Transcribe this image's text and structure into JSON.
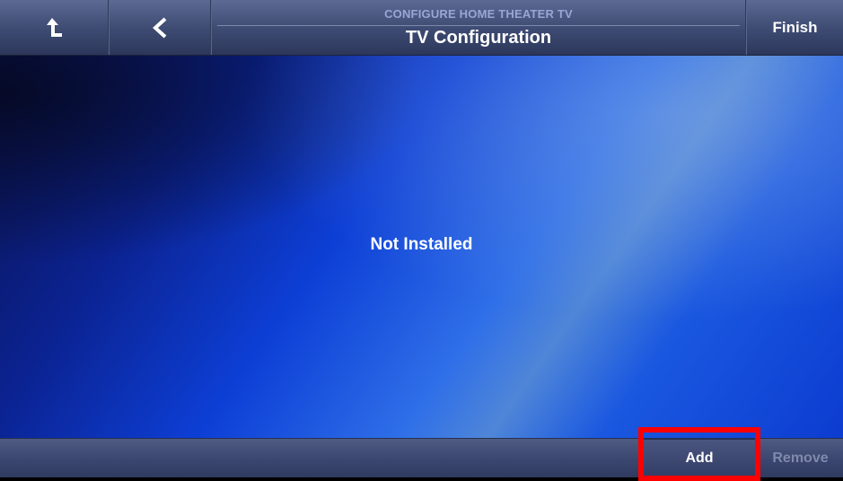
{
  "header": {
    "subtitle": "CONFIGURE HOME THEATER TV",
    "title": "TV Configuration",
    "finish_label": "Finish",
    "home_icon": "home-up-icon",
    "back_icon": "chevron-left-icon"
  },
  "main": {
    "status": "Not Installed"
  },
  "footer": {
    "add_label": "Add",
    "remove_label": "Remove",
    "highlight_color": "#ff0000"
  }
}
